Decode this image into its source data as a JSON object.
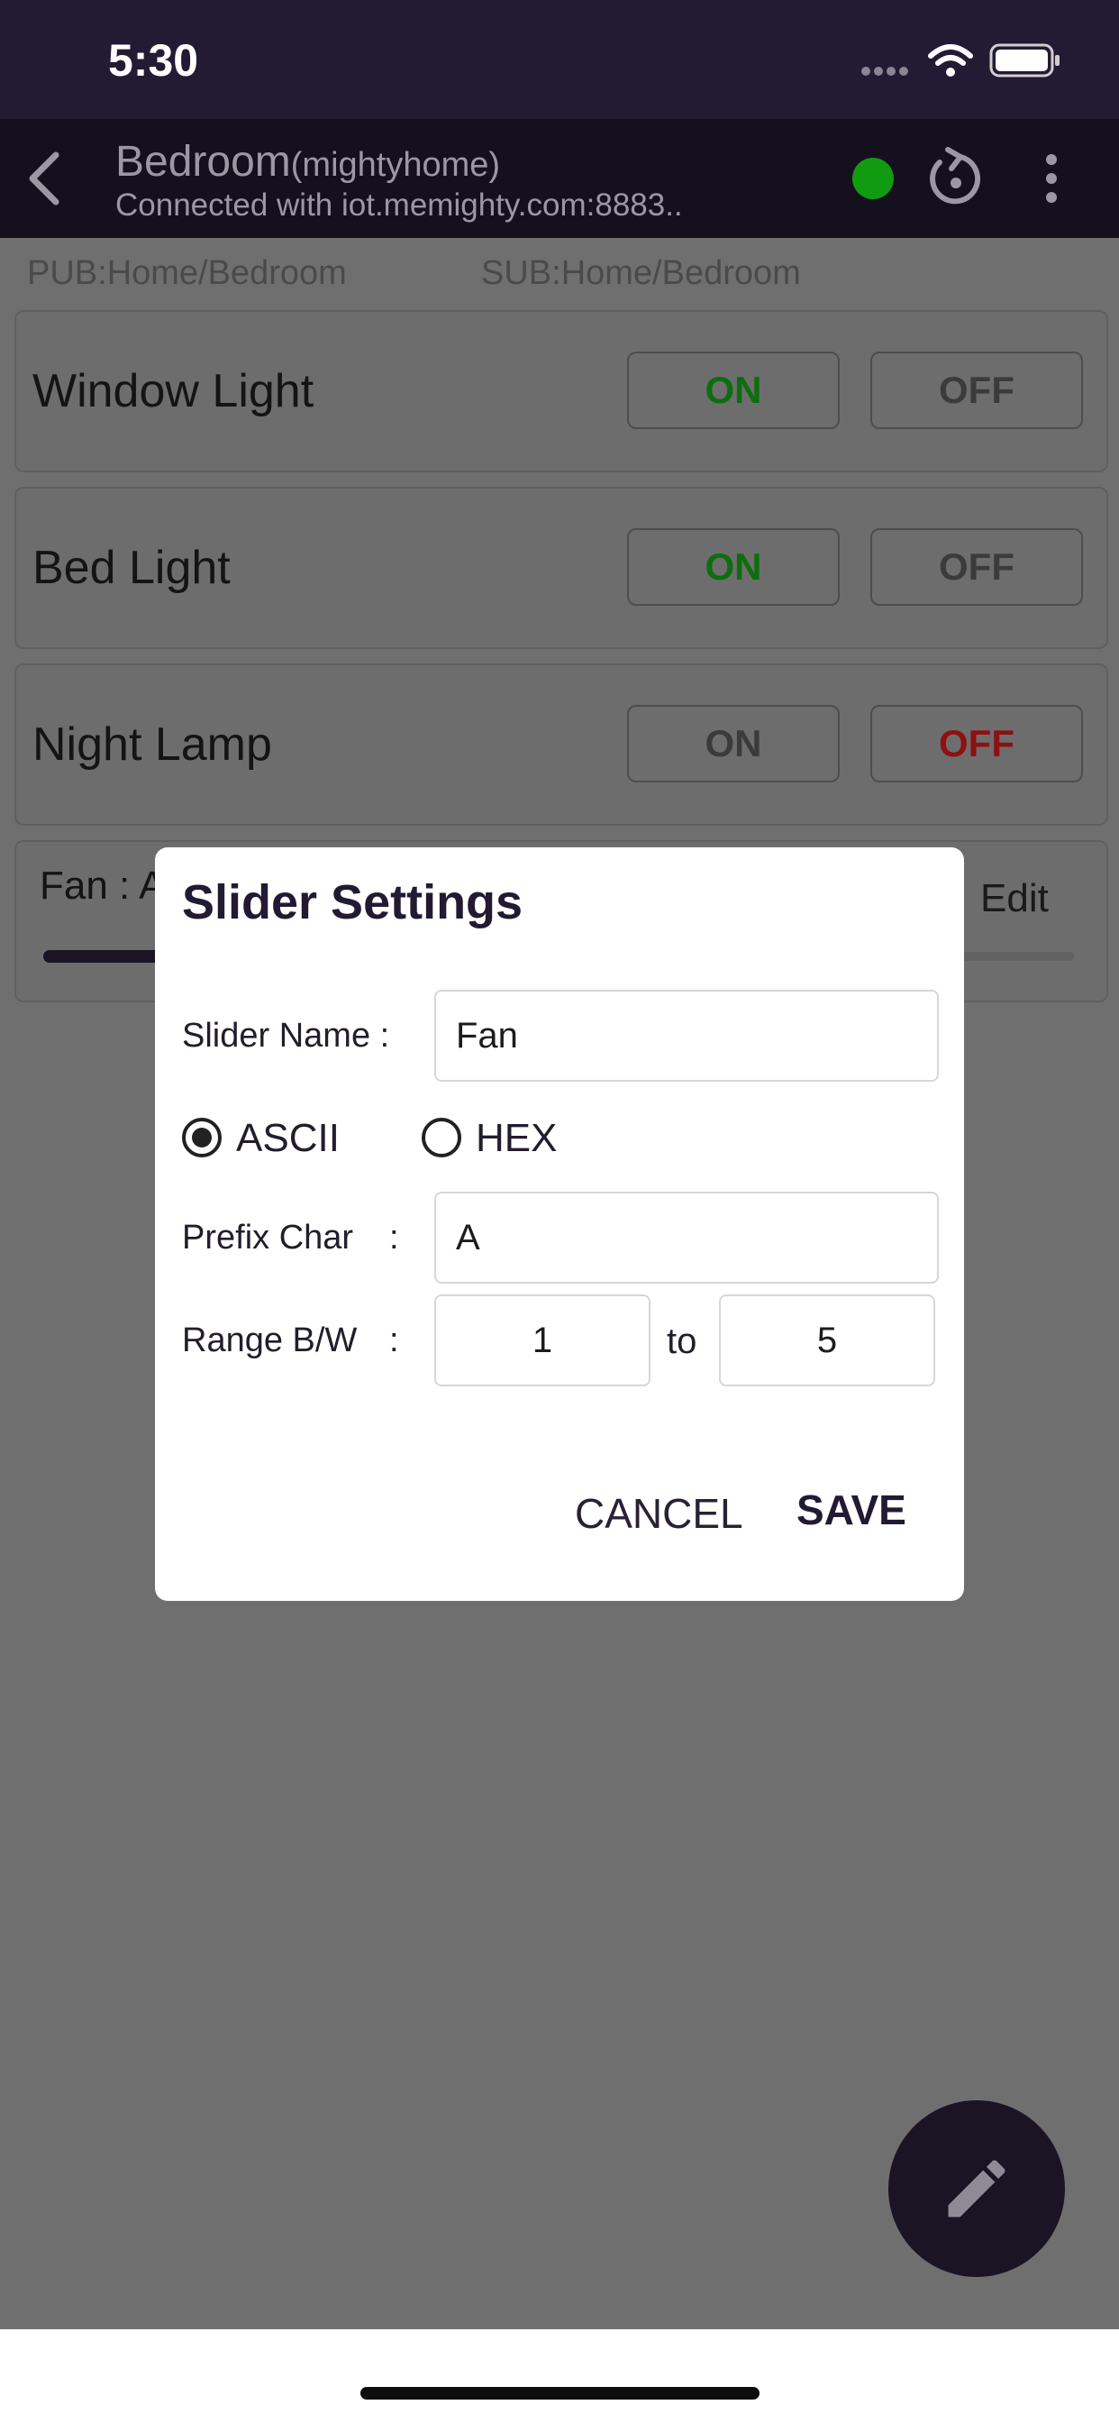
{
  "status": {
    "time": "5:30"
  },
  "appbar": {
    "title": "Bedroom",
    "title_sub": "(mightyhome)",
    "subtitle": "Connected with iot.memighty.com:8883..",
    "connection_color": "#119b11"
  },
  "topics": {
    "pub": "PUB:Home/Bedroom",
    "sub": "SUB:Home/Bedroom"
  },
  "switches": [
    {
      "label": "Window Light",
      "on_label": "ON",
      "off_label": "OFF",
      "state": "on"
    },
    {
      "label": "Bed Light",
      "on_label": "ON",
      "off_label": "OFF",
      "state": "on"
    },
    {
      "label": "Night Lamp",
      "on_label": "ON",
      "off_label": "OFF",
      "state": "off"
    }
  ],
  "slider_card": {
    "label": "Fan : A",
    "edit_label": "Edit"
  },
  "dialog": {
    "title": "Slider Settings",
    "name_label": "Slider Name :",
    "name_value": "Fan",
    "ascii_label": "ASCII",
    "hex_label": "HEX",
    "selected_encoding": "ASCII",
    "prefix_label": "Prefix Char",
    "prefix_colon": ":",
    "prefix_value": "A",
    "range_label": "Range B/W",
    "range_colon": ":",
    "range_from": "1",
    "range_to_label": "to",
    "range_to": "5",
    "cancel_label": "CANCEL",
    "save_label": "SAVE"
  },
  "colors": {
    "on_active": "#0c6e0c",
    "off_active": "#8e1010",
    "inactive": "#3b3b3b"
  },
  "icons": {
    "back": "chevron-left-icon",
    "refresh": "refresh-icon",
    "menu": "more-vertical-icon",
    "fab": "pencil-icon"
  }
}
